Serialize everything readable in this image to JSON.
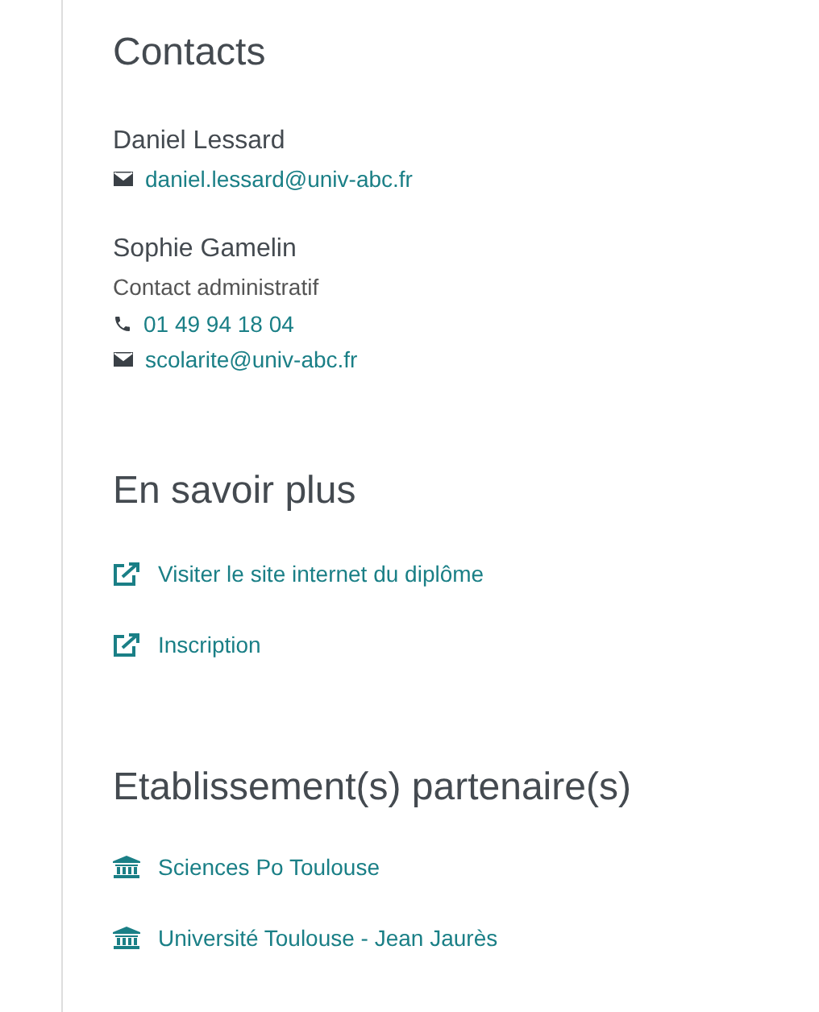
{
  "contacts": {
    "title": "Contacts",
    "people": [
      {
        "name": "Daniel Lessard",
        "lines": [
          {
            "kind": "email",
            "text": "daniel.lessard@univ-abc.fr"
          }
        ]
      },
      {
        "name": "Sophie Gamelin",
        "role": "Contact administratif",
        "lines": [
          {
            "kind": "phone",
            "text": "01 49 94 18 04"
          },
          {
            "kind": "email",
            "text": "scolarite@univ-abc.fr"
          }
        ]
      }
    ]
  },
  "more": {
    "title": "En savoir plus",
    "links": [
      {
        "text": "Visiter le site internet du diplôme"
      },
      {
        "text": "Inscription"
      }
    ]
  },
  "partners": {
    "title": "Etablissement(s) partenaire(s)",
    "items": [
      {
        "text": "Sciences Po Toulouse"
      },
      {
        "text": "Université Toulouse - Jean Jaurès"
      }
    ]
  }
}
